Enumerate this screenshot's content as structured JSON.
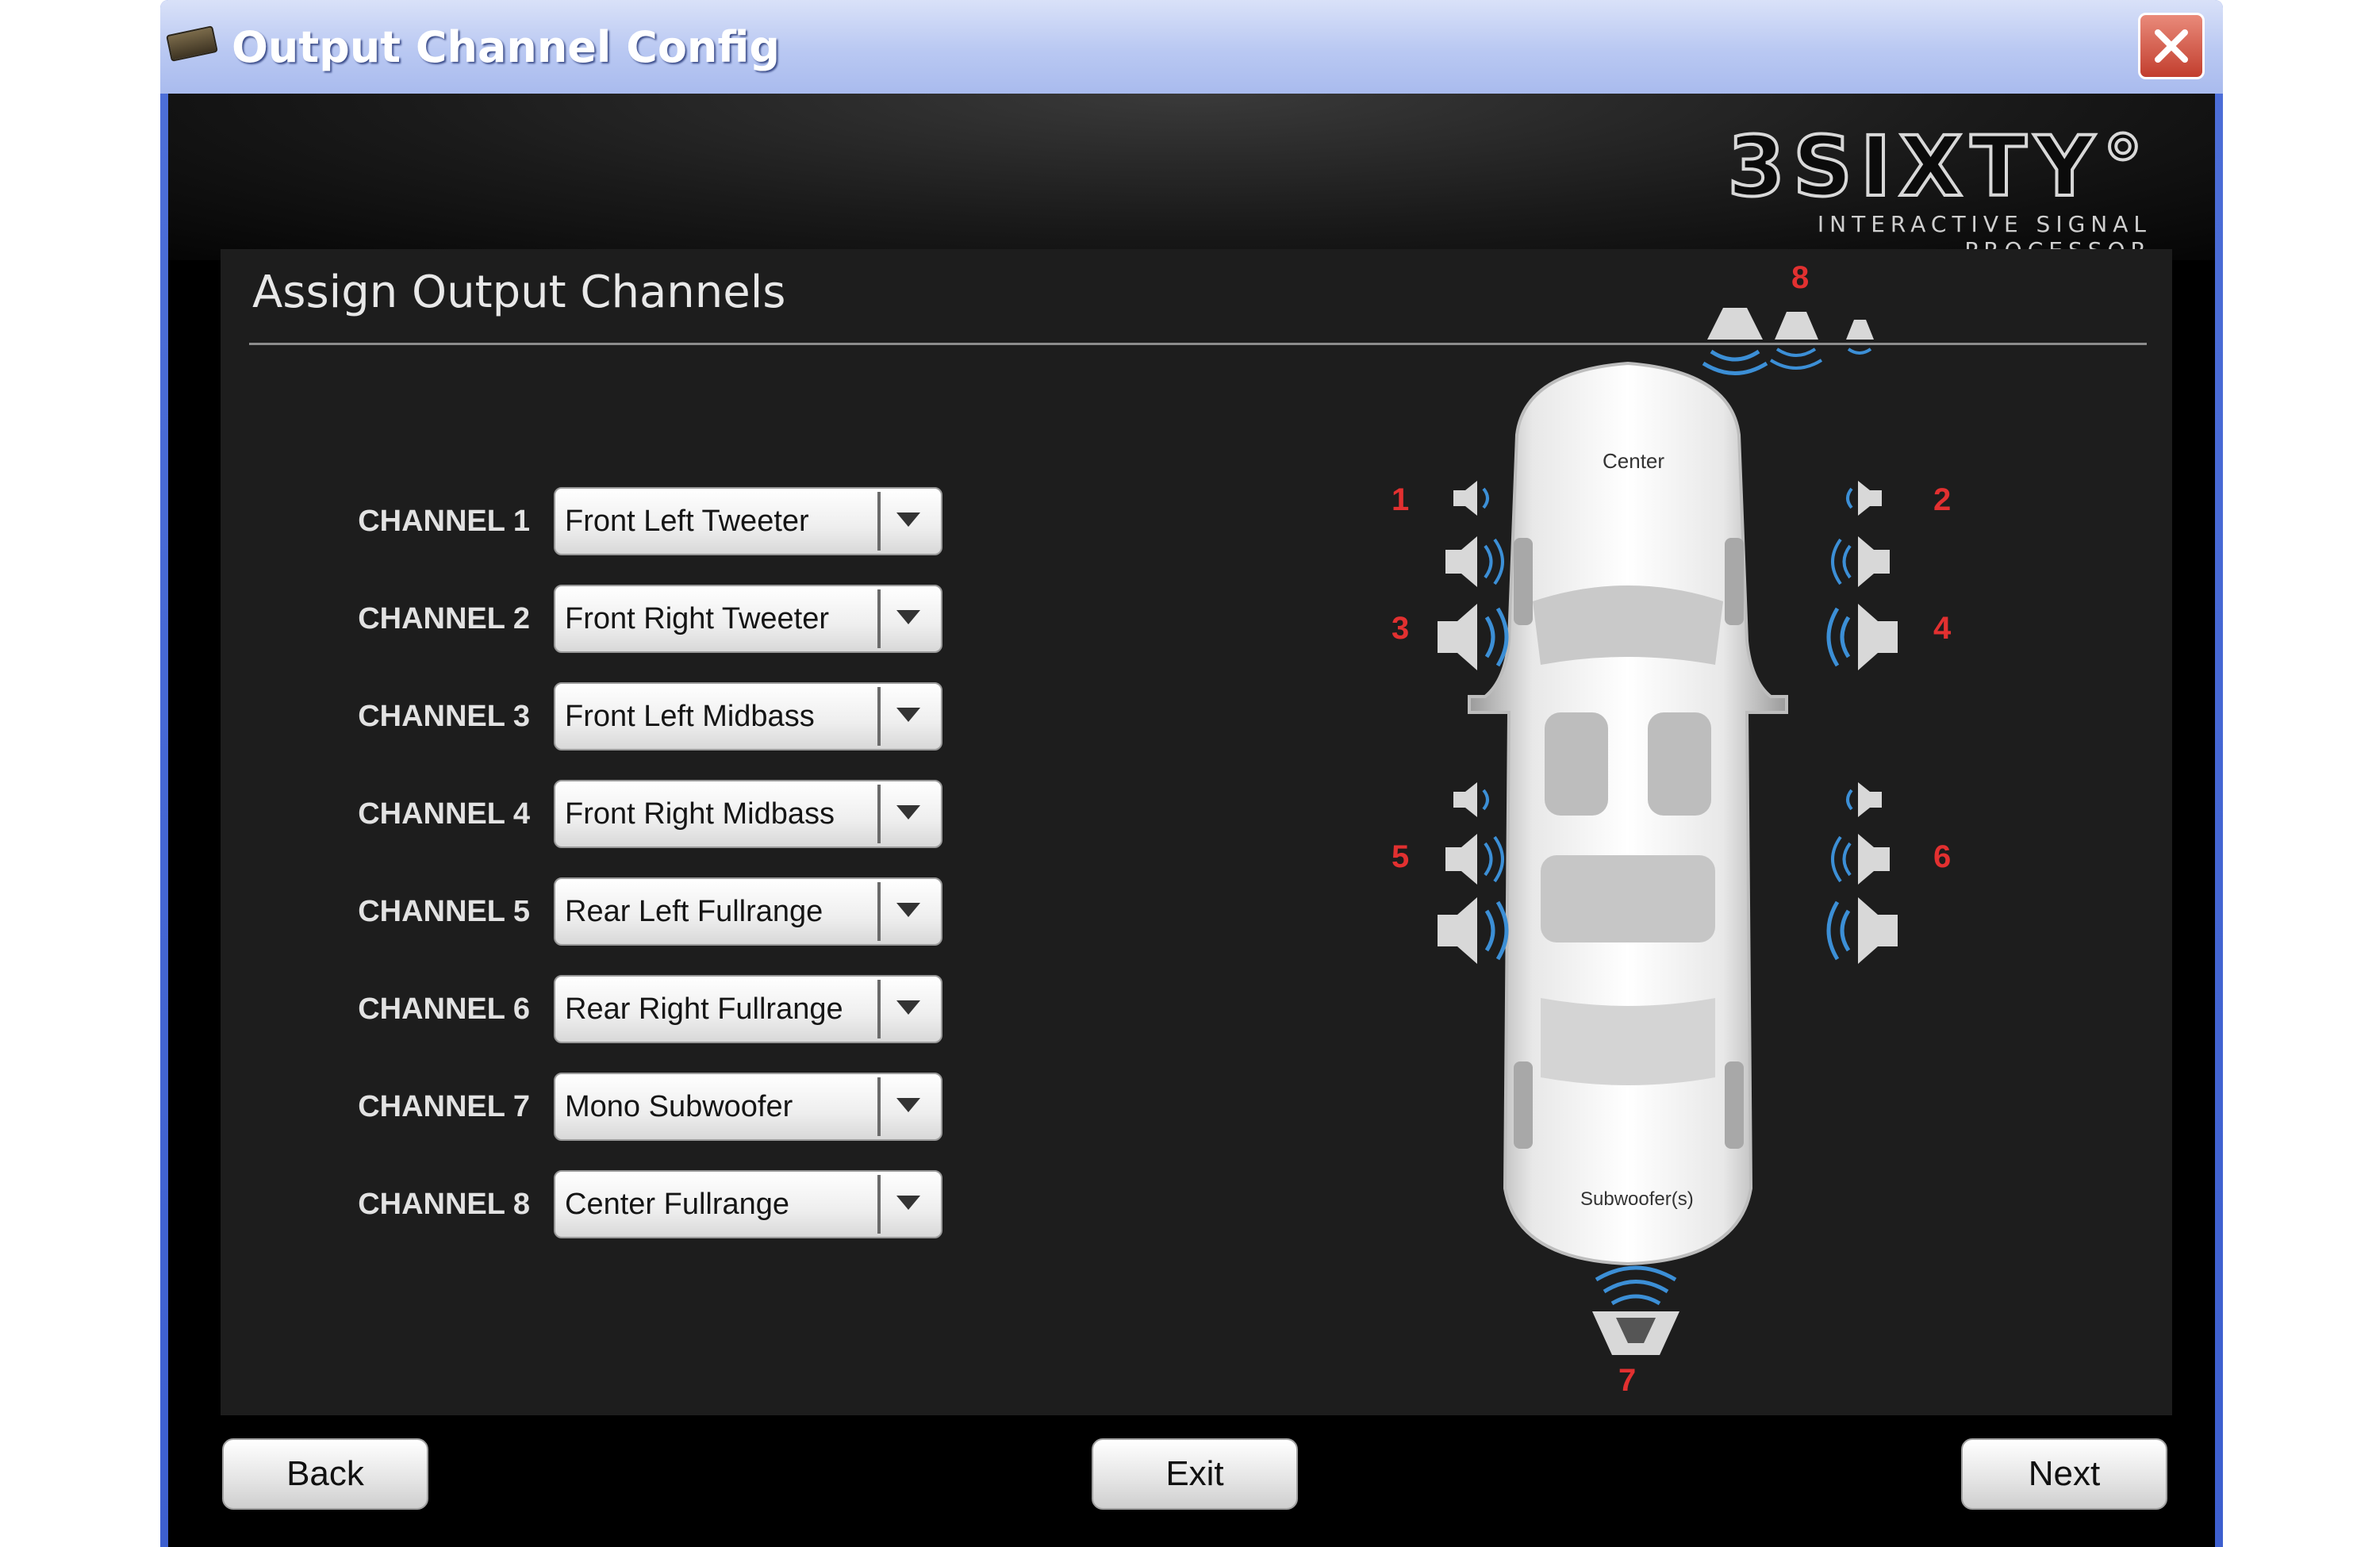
{
  "window": {
    "title": "Output Channel Config"
  },
  "logo": {
    "main": "3SIXTY°",
    "sub": "INTERACTIVE SIGNAL PROCESSOR"
  },
  "panel": {
    "title": "Assign Output Channels"
  },
  "channels": [
    {
      "label": "CHANNEL 1",
      "value": "Front Left Tweeter"
    },
    {
      "label": "CHANNEL 2",
      "value": "Front Right Tweeter"
    },
    {
      "label": "CHANNEL 3",
      "value": "Front Left Midbass"
    },
    {
      "label": "CHANNEL 4",
      "value": "Front Right Midbass"
    },
    {
      "label": "CHANNEL 5",
      "value": "Rear Left Fullrange"
    },
    {
      "label": "CHANNEL 6",
      "value": "Rear Right Fullrange"
    },
    {
      "label": "CHANNEL 7",
      "value": "Mono Subwoofer"
    },
    {
      "label": "CHANNEL 8",
      "value": "Center Fullrange"
    }
  ],
  "diagram": {
    "center_label": "Center",
    "sub_label": "Subwoofer(s)",
    "numbers": [
      "1",
      "2",
      "3",
      "4",
      "5",
      "6",
      "7",
      "8"
    ]
  },
  "buttons": {
    "back": "Back",
    "exit": "Exit",
    "next": "Next"
  },
  "colors": {
    "accent_number": "#e23030",
    "background": "#000000",
    "panel": "#1d1d1d"
  },
  "icons": {
    "close": "close-icon",
    "dropdown": "chevron-down-icon",
    "speaker": "speaker-icon"
  }
}
